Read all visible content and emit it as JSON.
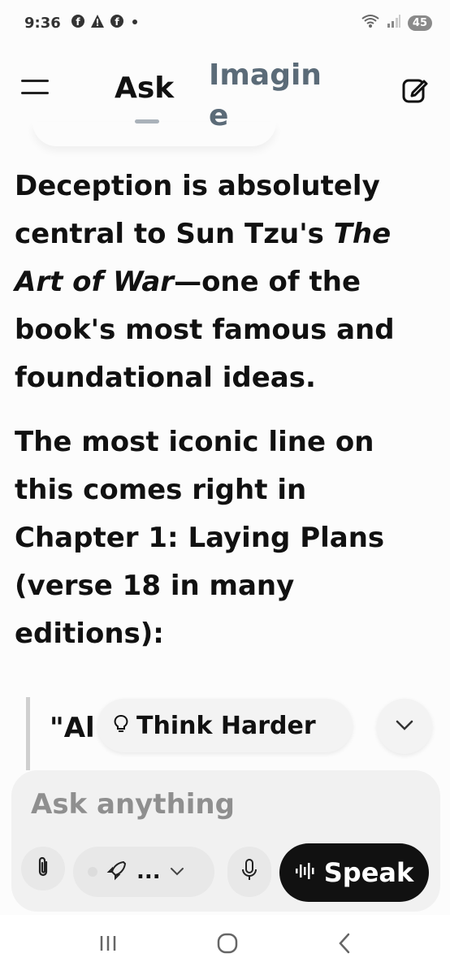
{
  "status_bar": {
    "time": "9:36",
    "battery": "45",
    "icons": [
      "facebook-icon",
      "warning-icon",
      "facebook-icon",
      "dot-icon",
      "wifi-icon",
      "signal-icon"
    ]
  },
  "nav": {
    "tabs": [
      {
        "label": "Ask",
        "active": true
      },
      {
        "label": "Imagine",
        "active": false
      }
    ],
    "icons": [
      "menu-icon",
      "edit-icon"
    ]
  },
  "content": {
    "p1_before": "Deception is absolutely central to Sun Tzu's ",
    "p1_title": "The Art of War",
    "p1_after": "—one of the book's most famous and foundational ideas.",
    "p2": "The most iconic line on this comes right in Chapter 1: Laying Plans (verse 18 in many editions):",
    "quote_partial": "\"Al"
  },
  "overlay": {
    "think_harder": "Think Harder",
    "think_icon": "lightbulb-icon",
    "scroll_icon": "chevron-down-icon"
  },
  "composer": {
    "placeholder": "Ask anything",
    "mode_label": "...",
    "mode_icon": "rocket-icon",
    "speak_label": "Speak",
    "icons": [
      "paperclip-icon",
      "chevron-down-icon",
      "microphone-icon",
      "waveform-icon"
    ]
  },
  "colors": {
    "accent_tab_inactive": "#5b6b78",
    "speak_bg": "#111111",
    "composer_bg": "#f1f1f1"
  }
}
